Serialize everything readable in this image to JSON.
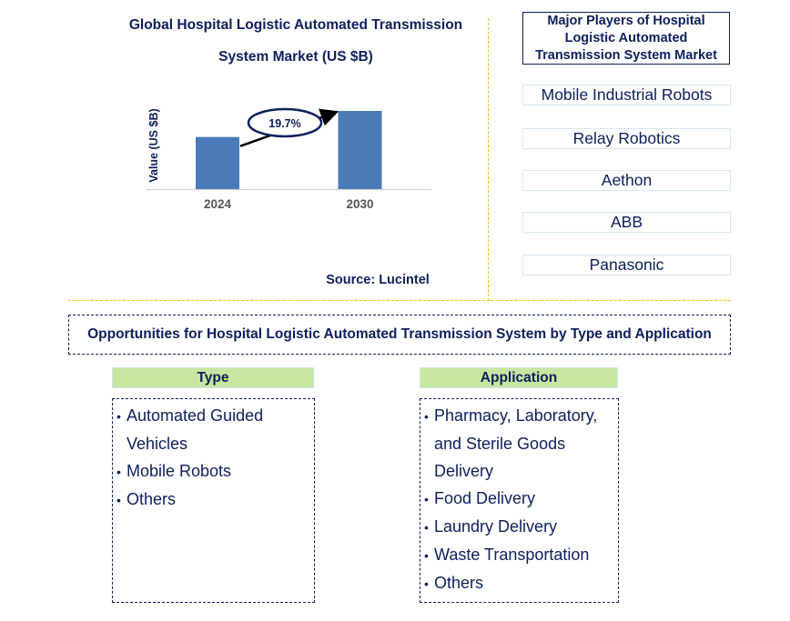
{
  "chart_data": {
    "type": "bar",
    "title": "Global Hospital Logistic Automated Transmission System Market (US $B)",
    "title_lines": [
      "Global Hospital Logistic Automated Transmission",
      "System Market (US $B)"
    ],
    "categories": [
      "2024",
      "2030"
    ],
    "values": [
      2.0,
      3.0
    ],
    "values_note": "No value labels shown; relative heights estimated",
    "xlabel": "",
    "ylabel": "Value (US $B)",
    "grid": false,
    "annotation": {
      "text": "19.7%",
      "meaning": "CAGR 2024-2030",
      "shape": "ellipse-with-arrow"
    },
    "bar_color": "#4a7ab8",
    "source": "Source: Lucintel"
  },
  "players": {
    "title": "Major Players of Hospital Logistic Automated Transmission System Market",
    "title_lines": [
      "Major Players of Hospital",
      "Logistic Automated",
      "Transmission System Market"
    ],
    "items": [
      "Mobile Industrial Robots",
      "Relay Robotics",
      "Aethon",
      "ABB",
      "Panasonic"
    ]
  },
  "opportunities": {
    "title": "Opportunities for Hospital Logistic Automated Transmission System by Type and Application",
    "type": {
      "header": "Type",
      "items": [
        "Automated Guided Vehicles",
        "Mobile Robots",
        "Others"
      ]
    },
    "application": {
      "header": "Application",
      "items": [
        "Pharmacy, Laboratory, and Sterile Goods Delivery",
        "Food Delivery",
        "Laundry Delivery",
        "Waste Transportation",
        "Others"
      ]
    }
  },
  "colors": {
    "text": "#0d1f5c",
    "bar": "#4a7ab8",
    "divider": "#f5b800",
    "header_fill": "#c8e6a0",
    "player_border": "#d6e8f3"
  },
  "bullet": "•"
}
